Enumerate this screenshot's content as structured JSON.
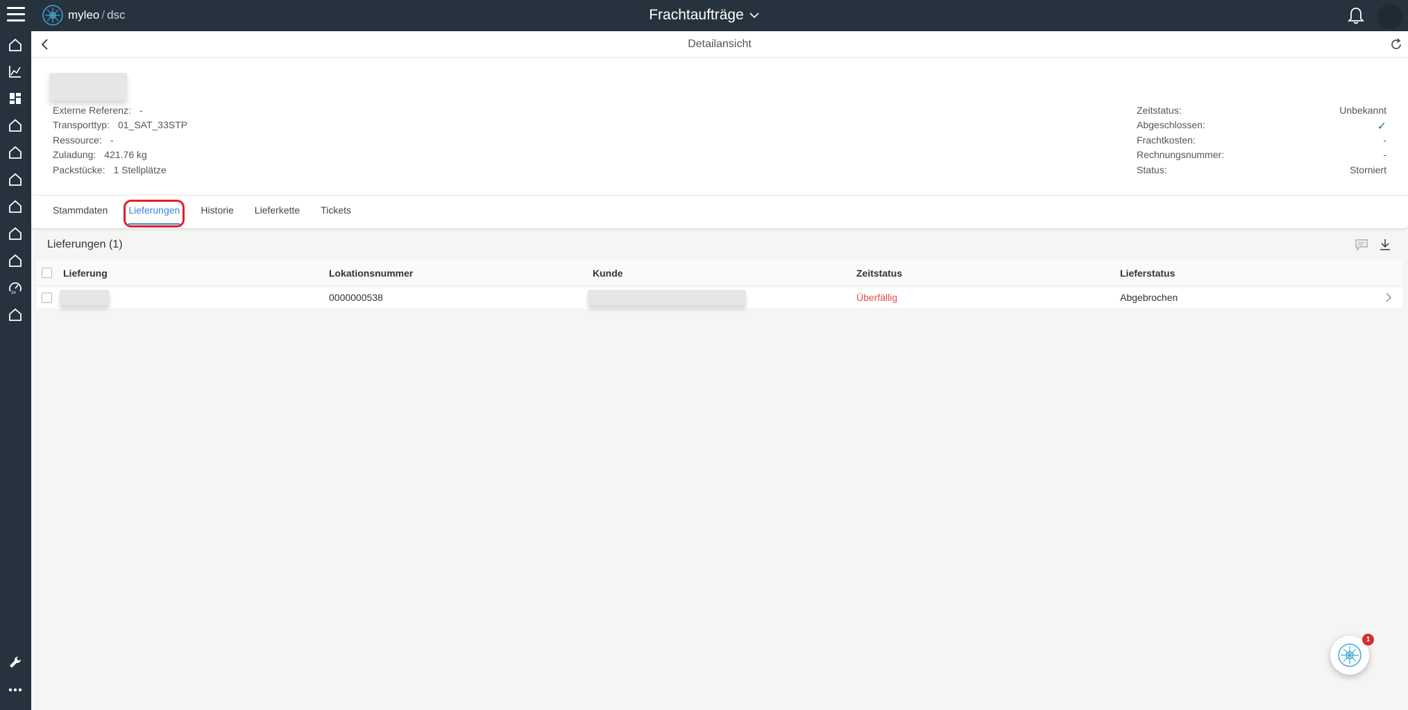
{
  "app": {
    "logo_name": "myleo",
    "logo_sub": "dsc",
    "title": "Frachtaufträge"
  },
  "detail": {
    "title": "Detailansicht"
  },
  "info_left": [
    {
      "label": "Externe Referenz:",
      "value": "-"
    },
    {
      "label": "Transporttyp:",
      "value": "01_SAT_33STP"
    },
    {
      "label": "Ressource:",
      "value": "-"
    },
    {
      "label": "Zuladung:",
      "value": "421.76 kg"
    },
    {
      "label": "Packstücke:",
      "value": "1 Stellplätze"
    }
  ],
  "info_right": [
    {
      "label": "Zeitstatus:",
      "value": "Unbekannt"
    },
    {
      "label": "Abgeschlossen:",
      "value": "✓"
    },
    {
      "label": "Frachtkosten:",
      "value": "-"
    },
    {
      "label": "Rechnungsnummer:",
      "value": "-"
    },
    {
      "label": "Status:",
      "value": "Storniert"
    }
  ],
  "tabs": [
    {
      "label": "Stammdaten",
      "active": false
    },
    {
      "label": "Lieferungen",
      "active": true
    },
    {
      "label": "Historie",
      "active": false
    },
    {
      "label": "Lieferkette",
      "active": false
    },
    {
      "label": "Tickets",
      "active": false
    }
  ],
  "list": {
    "title": "Lieferungen (1)",
    "columns": [
      "Lieferung",
      "Lokationsnummer",
      "Kunde",
      "Zeitstatus",
      "Lieferstatus"
    ],
    "rows": [
      {
        "lieferung": "",
        "lokationsnummer": "0000000538",
        "kunde": "",
        "zeitstatus": "Überfällig",
        "lieferstatus": "Abgebrochen"
      }
    ]
  },
  "assistant": {
    "badge_count": "1"
  },
  "colors": {
    "topbar": "#26323d",
    "accent": "#3a82d8",
    "overdue": "#e84a4a",
    "highlight": "#e21e26"
  }
}
